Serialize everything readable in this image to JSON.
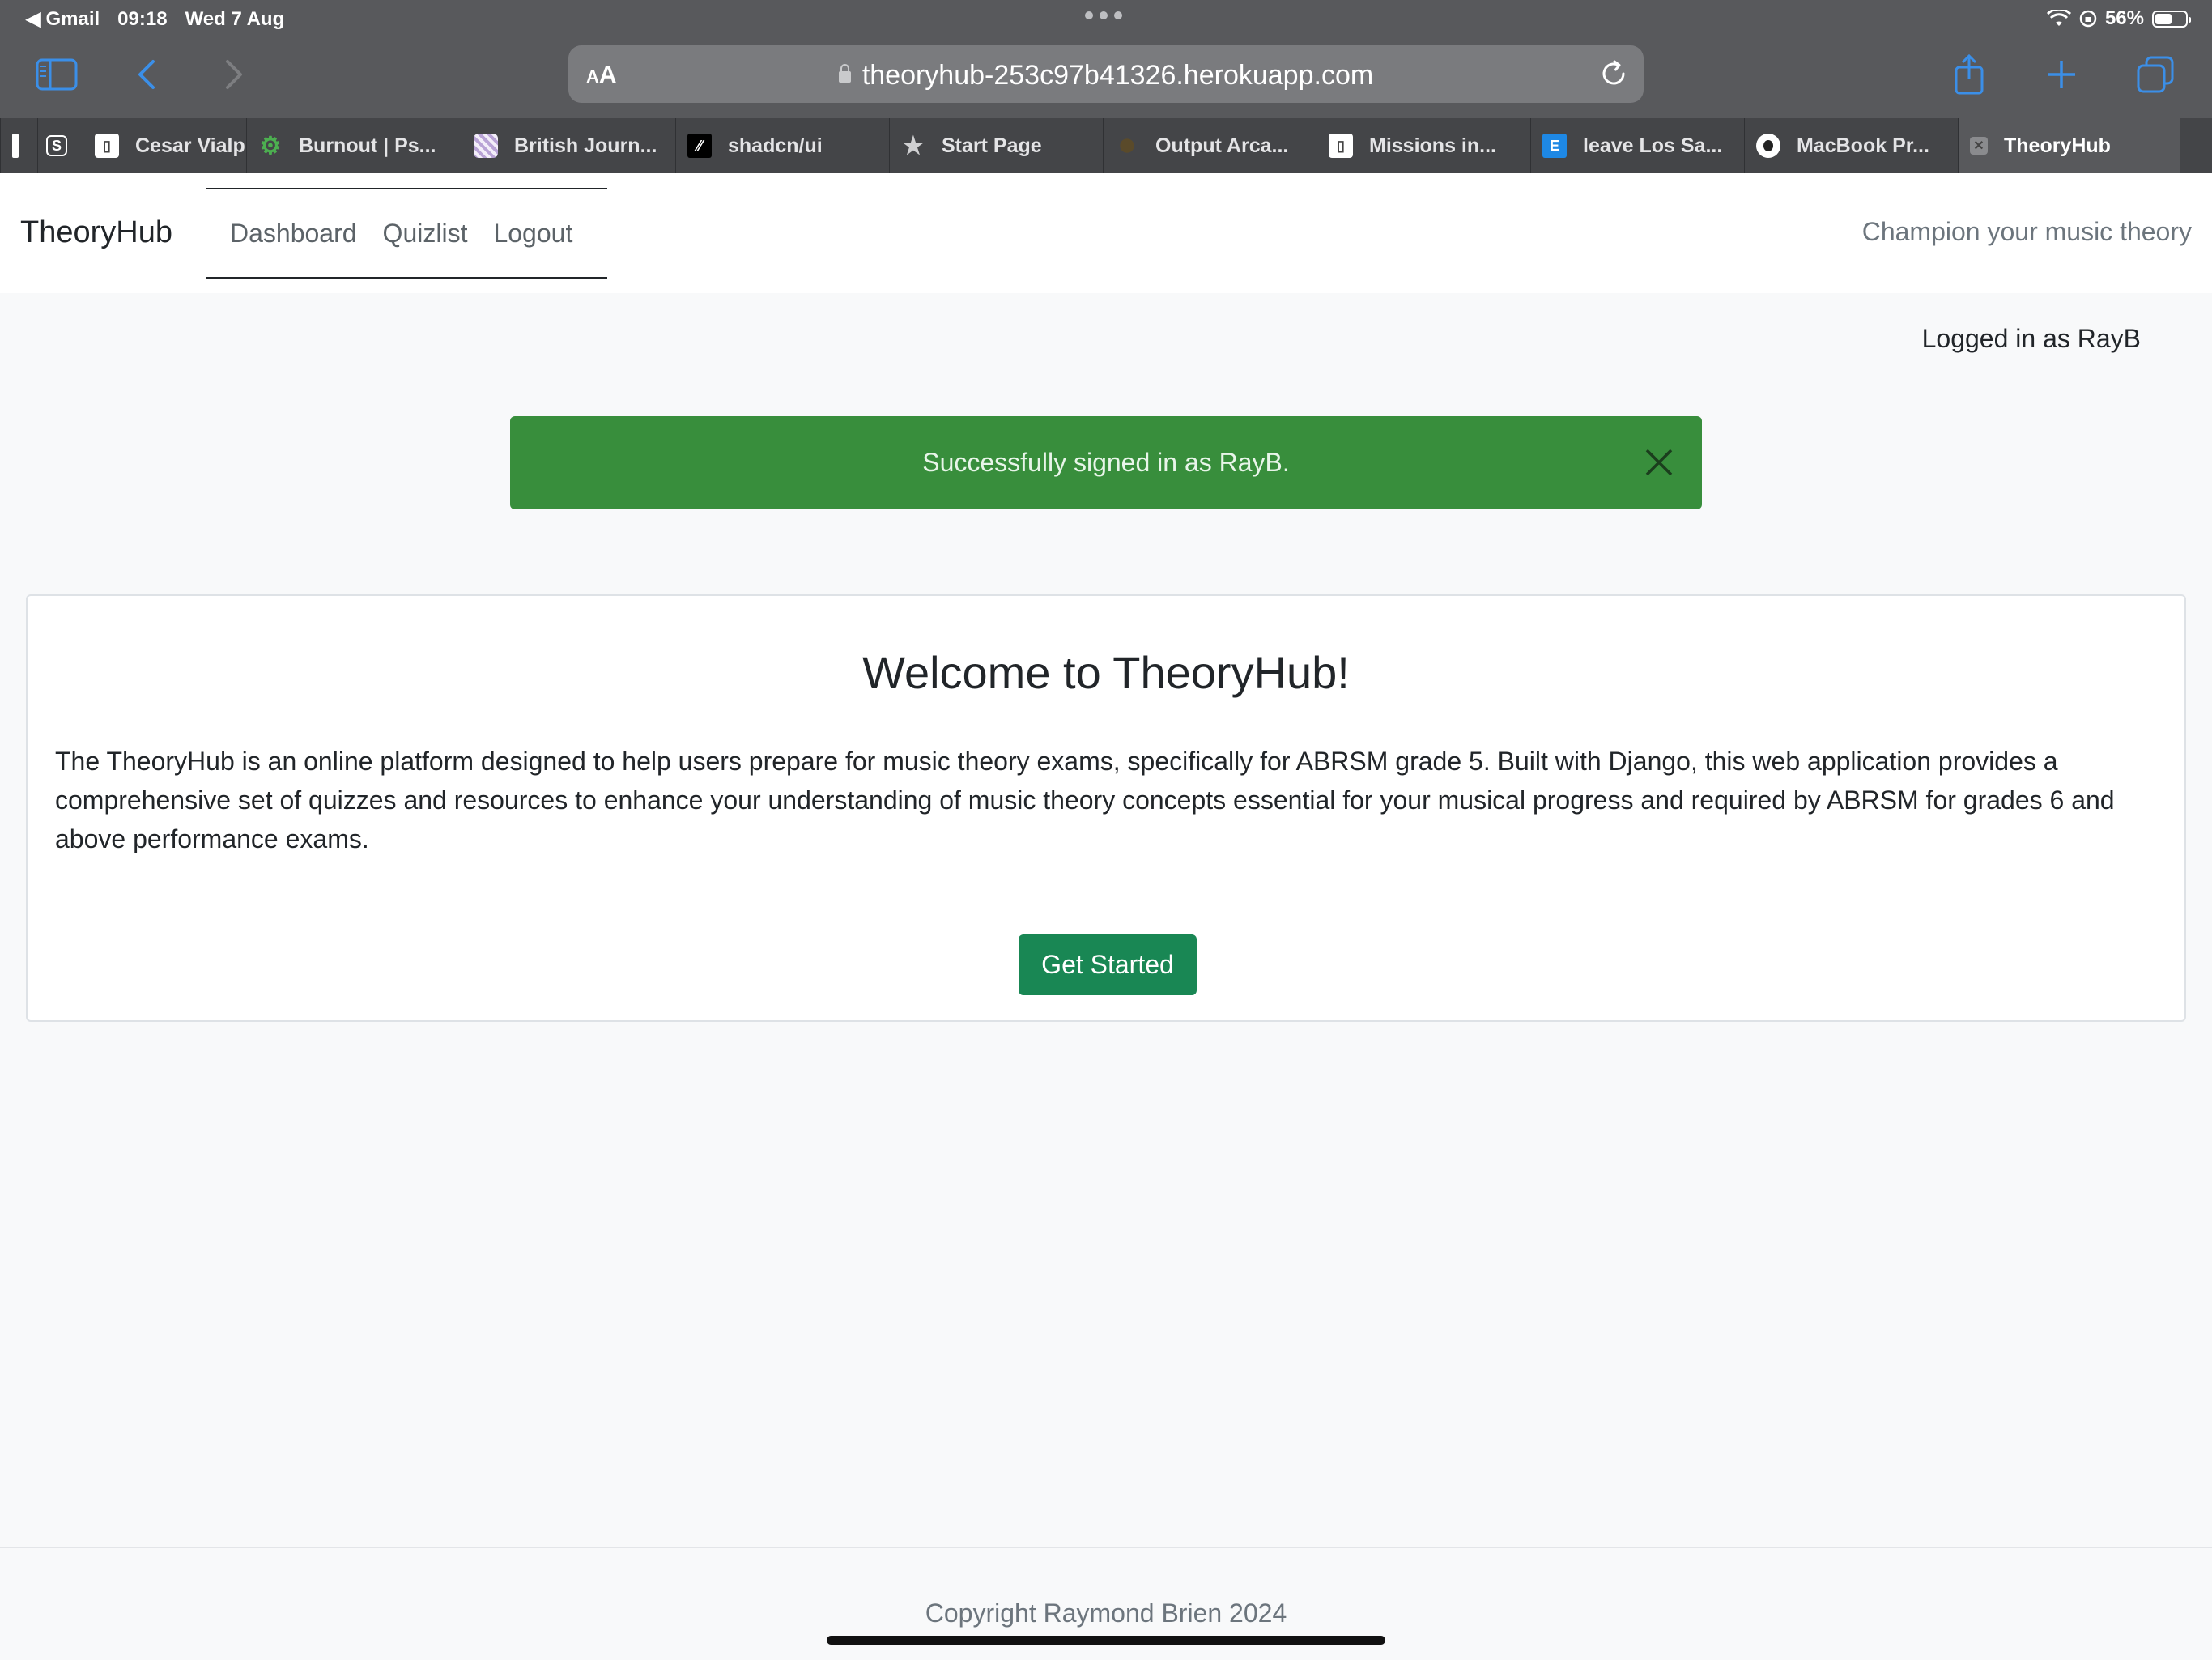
{
  "status_bar": {
    "back_app": "Gmail",
    "time": "09:18",
    "date": "Wed 7 Aug",
    "battery": "56%",
    "battery_level": 0.56
  },
  "browser": {
    "aa_label_small": "A",
    "aa_label": "A",
    "url": "theoryhub-253c97b41326.herokuapp.com",
    "tabs": [
      {
        "title": "",
        "icon": "red-mark-icon"
      },
      {
        "title": "",
        "icon": "s-box-icon"
      },
      {
        "title": "Cesar Vialp",
        "icon": "page-icon"
      },
      {
        "title": "Burnout | Ps...",
        "icon": "gear-green-icon"
      },
      {
        "title": "British Journ...",
        "icon": "pattern-icon"
      },
      {
        "title": "shadcn/ui",
        "icon": "slash-icon"
      },
      {
        "title": "Start Page",
        "icon": "star-icon"
      },
      {
        "title": "Output Arca...",
        "icon": "circle-icon"
      },
      {
        "title": "Missions in...",
        "icon": "page-icon"
      },
      {
        "title": "leave Los Sa...",
        "icon": "e-box-icon"
      },
      {
        "title": "MacBook Pr...",
        "icon": "apple-icon"
      },
      {
        "title": "TheoryHub",
        "icon": "close-tab-icon"
      }
    ]
  },
  "navbar": {
    "brand": "TheoryHub",
    "links": [
      "Dashboard",
      "Quizlist",
      "Logout"
    ],
    "tagline": "Champion your music theory"
  },
  "user": {
    "logged_in_text": "Logged in as RayB"
  },
  "alert": {
    "message": "Successfully signed in as RayB.",
    "color": "#388e3c"
  },
  "welcome": {
    "title": "Welcome to TheoryHub!",
    "body": "The TheoryHub is an online platform designed to help users prepare for music theory exams, specifically for ABRSM grade 5. Built with Django, this web application provides a comprehensive set of quizzes and resources to enhance your understanding of music theory concepts essential for your musical progress and required by ABRSM for grades 6 and above performance exams.",
    "button": "Get Started",
    "button_color": "#198754"
  },
  "footer": {
    "copyright": "Copyright Raymond Brien 2024"
  }
}
